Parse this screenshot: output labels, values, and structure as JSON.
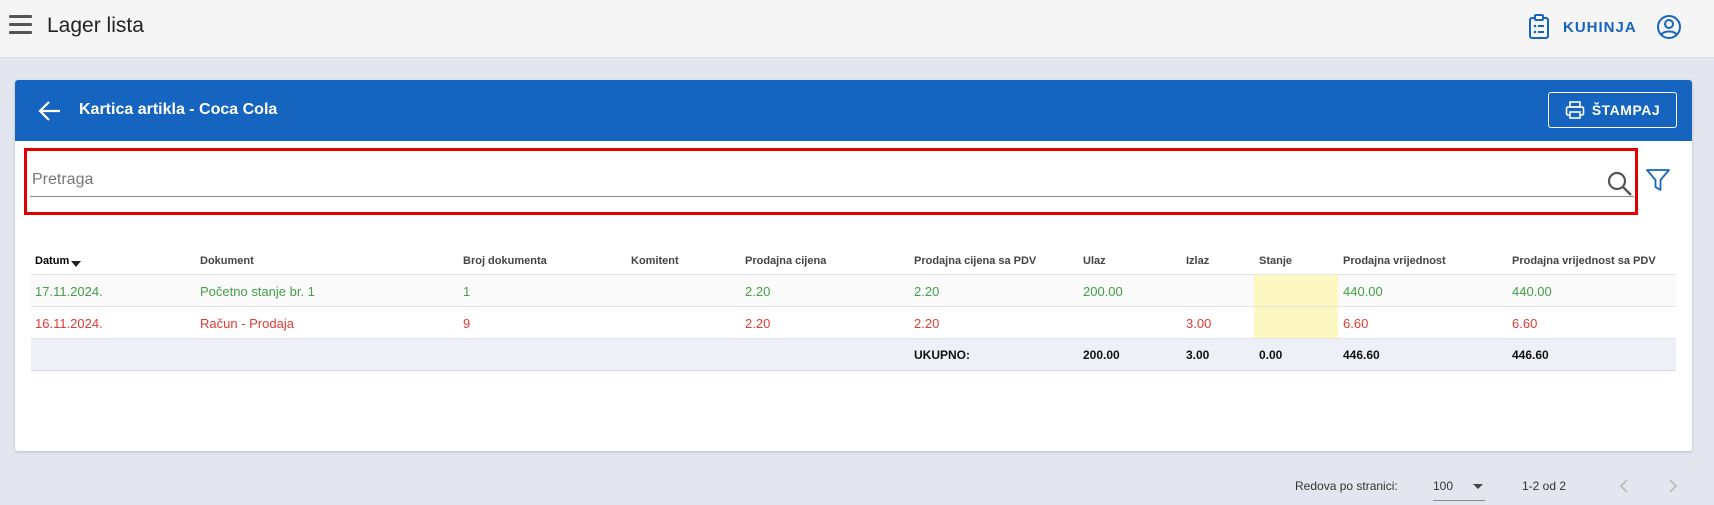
{
  "topbar": {
    "title": "Lager lista",
    "kitchen_label": "KUHINJA"
  },
  "card": {
    "title": "Kartica artikla - Coca Cola",
    "print_label": "ŠTAMPAJ",
    "search_placeholder": "Pretraga"
  },
  "table": {
    "columns": [
      "Datum",
      "Dokument",
      "Broj dokumenta",
      "Komitent",
      "Prodajna cijena",
      "Prodajna cijena sa PDV",
      "Ulaz",
      "Izlaz",
      "Stanje",
      "Prodajna vrijednost",
      "Prodajna vrijednost sa PDV"
    ],
    "sorted_column": "Datum",
    "sort_direction": "descending",
    "rows": [
      {
        "datum": "17.11.2024.",
        "dokument": "Početno stanje br. 1",
        "broj": "1",
        "komitent": "",
        "cijena": "2.20",
        "cijena_pdv": "2.20",
        "ulaz": "200.00",
        "izlaz": "",
        "stanje": "",
        "vrijednost": "440.00",
        "vrijednost_pdv": "440.00",
        "status_color": "#43a047"
      },
      {
        "datum": "16.11.2024.",
        "dokument": "Račun - Prodaja",
        "broj": "9",
        "komitent": "",
        "cijena": "2.20",
        "cijena_pdv": "2.20",
        "ulaz": "",
        "izlaz": "3.00",
        "stanje": "",
        "vrijednost": "6.60",
        "vrijednost_pdv": "6.60",
        "status_color": "#e53935"
      }
    ],
    "totals": {
      "label": "UKUPNO:",
      "ulaz": "200.00",
      "izlaz": "3.00",
      "stanje": "0.00",
      "vrijednost": "446.60",
      "vrijednost_pdv": "446.60"
    }
  },
  "pagination": {
    "rows_per_page_label": "Redova po stranici:",
    "rows_per_page": "100",
    "range": "1-2 od 2"
  },
  "colors": {
    "primary": "#1565c0",
    "highlight": "#e00000",
    "stock_highlight": "#fdf7c2"
  },
  "icons": [
    "menu-icon",
    "clipboard-icon",
    "account-icon",
    "back-arrow-icon",
    "printer-icon",
    "search-icon",
    "filter-icon",
    "chevron-left-icon",
    "chevron-right-icon"
  ]
}
